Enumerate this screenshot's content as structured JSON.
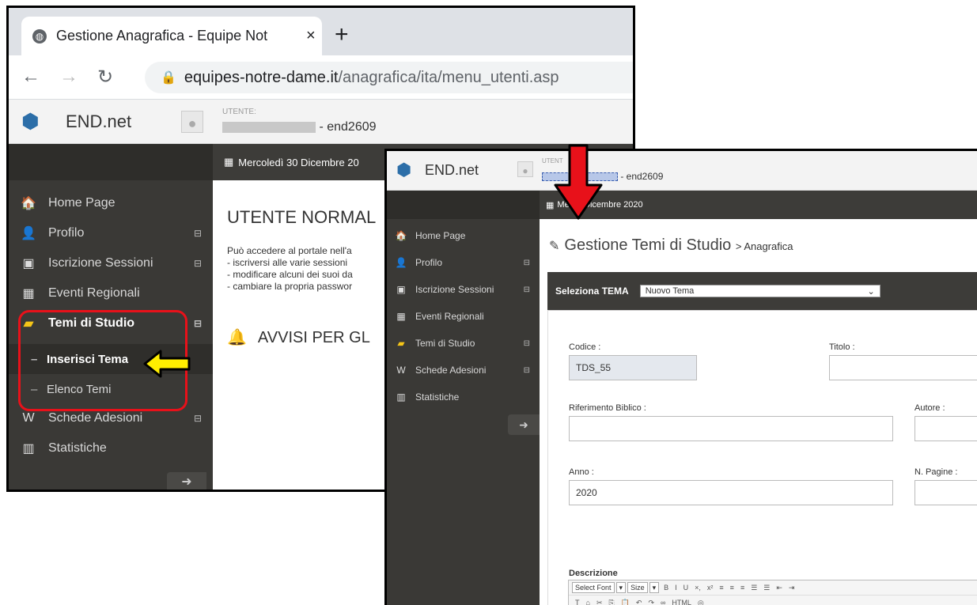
{
  "colors": {
    "sidebar": "#3a3936",
    "accent_red": "#e8111a",
    "arrow_yellow": "#ffee00",
    "brand_blue": "#2c6ea8"
  },
  "browser": {
    "tab_title": "Gestione Anagrafica - Equipe Not",
    "tab_close": "×",
    "new_tab": "+",
    "url_host": "equipes-notre-dame.it",
    "url_path": "/anagrafica/ita/menu_utenti.asp",
    "icons": [
      "back-icon",
      "forward-icon",
      "reload-icon",
      "lock-icon",
      "globe-icon"
    ]
  },
  "app1": {
    "brand": "END.net",
    "user_label": "UTENTE:",
    "user_suffix": " - end2609",
    "date": "Mercoledì 30 Dicembre 20",
    "menu": [
      {
        "label": "Home Page",
        "icon": "home-icon",
        "glyph": "🏠"
      },
      {
        "label": "Profilo",
        "icon": "user-icon",
        "glyph": "👤",
        "expand": "⊟"
      },
      {
        "label": "Iscrizione Sessioni",
        "icon": "inbox-icon",
        "glyph": "▣",
        "expand": "⊟"
      },
      {
        "label": "Eventi Regionali",
        "icon": "calendar-icon",
        "glyph": "▦"
      },
      {
        "label": "Temi di Studio",
        "icon": "book-icon",
        "glyph": "▰",
        "expand": "⊟"
      },
      {
        "label": "Schede Adesioni",
        "icon": "word-doc-icon",
        "glyph": "W",
        "expand": "⊟"
      },
      {
        "label": "Statistiche",
        "icon": "chart-icon",
        "glyph": "▥"
      }
    ],
    "submenu": [
      "Inserisci Tema",
      "Elenco Temi"
    ],
    "heading": "UTENTE NORMAL",
    "para": [
      "Può accedere al portale nell'a",
      "- iscriversi alle varie sessioni",
      "- modificare alcuni dei suoi da",
      "- cambiare la propria passwor"
    ],
    "avvisi": "AVVISI PER GL"
  },
  "app2": {
    "brand": "END.net",
    "user_label": "UTENT",
    "user_suffix": " - end2609",
    "date": "Me  30 Dicembre 2020",
    "menu": [
      {
        "label": "Home Page",
        "icon": "home-icon",
        "glyph": "🏠"
      },
      {
        "label": "Profilo",
        "icon": "user-icon",
        "glyph": "👤",
        "expand": "⊟"
      },
      {
        "label": "Iscrizione Sessioni",
        "icon": "inbox-icon",
        "glyph": "▣",
        "expand": "⊟"
      },
      {
        "label": "Eventi Regionali",
        "icon": "calendar-icon",
        "glyph": "▦"
      },
      {
        "label": "Temi di Studio",
        "icon": "book-icon",
        "glyph": "▰",
        "expand": "⊟"
      },
      {
        "label": "Schede Adesioni",
        "icon": "word-doc-icon",
        "glyph": "W",
        "expand": "⊟"
      },
      {
        "label": "Statistiche",
        "icon": "chart-icon",
        "glyph": "▥"
      }
    ],
    "page_title": "Gestione Temi di Studio",
    "page_sub": "> Anagrafica",
    "select_label": "Seleziona TEMA",
    "select_value": "Nuovo Tema",
    "form": {
      "codice_label": "Codice :",
      "codice_value": "TDS_55",
      "titolo_label": "Titolo :",
      "riferimento_label": "Riferimento Biblico :",
      "autore_label": "Autore :",
      "anno_label": "Anno :",
      "anno_value": "2020",
      "pagine_label": "N. Pagine :",
      "descrizione_label": "Descrizione"
    },
    "editor": {
      "font_select": "Select Font",
      "size_select": "Size",
      "buttons": [
        "B",
        "I",
        "U",
        "×,",
        "x²",
        "≡",
        "≡",
        "≡",
        "☰",
        "☰",
        "⇤",
        "⇥"
      ],
      "buttons2": [
        "T",
        "⌂",
        "✂",
        "⎘",
        "📋",
        "↶",
        "↷",
        "∞",
        "HTML",
        "◎"
      ]
    }
  }
}
